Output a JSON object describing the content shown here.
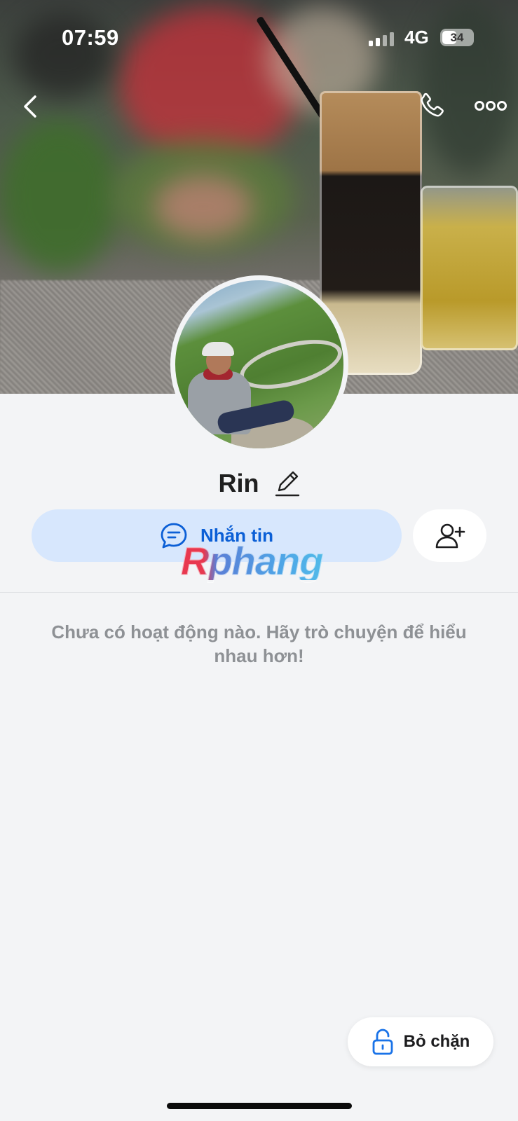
{
  "status_bar": {
    "time": "07:59",
    "network": "4G",
    "battery": "34"
  },
  "header": {
    "back_icon": "chevron-left-icon",
    "call_icon": "phone-icon",
    "more_icon": "more-horizontal-icon"
  },
  "profile": {
    "name": "Rin",
    "edit_icon": "pencil-icon"
  },
  "actions": {
    "message_label": "Nhắn tin",
    "message_icon": "chat-bubble-icon",
    "add_friend_icon": "add-user-icon"
  },
  "watermark": "Rphang",
  "activity": {
    "empty_text": "Chưa có hoạt động nào. Hãy trò chuyện để hiểu nhau hơn!"
  },
  "unblock": {
    "label": "Bỏ chặn",
    "icon": "unlock-icon"
  },
  "colors": {
    "accent": "#0b5fd6",
    "message_bg": "#d7e7fd",
    "page_bg": "#f3f4f6",
    "muted_text": "#8e9195"
  }
}
